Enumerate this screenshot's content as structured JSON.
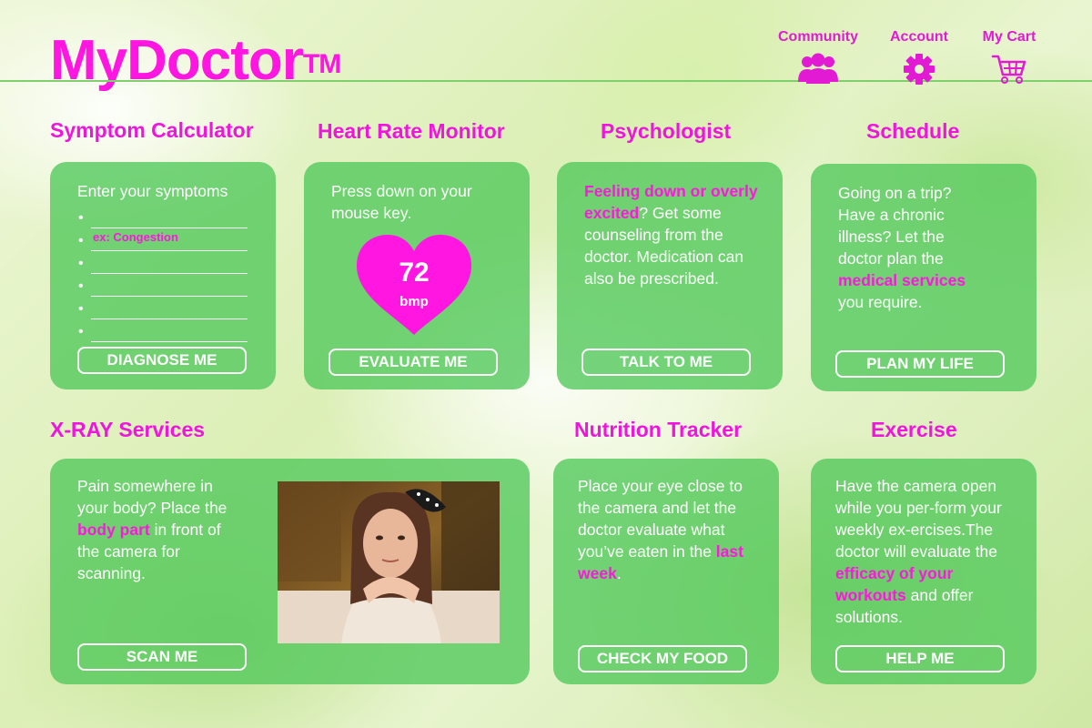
{
  "header": {
    "logo": "MyDoctor",
    "logo_mark": "TM",
    "nav": [
      {
        "label": "Community",
        "icon": "community-icon"
      },
      {
        "label": "Account",
        "icon": "gear-icon"
      },
      {
        "label": "My Cart",
        "icon": "cart-icon"
      }
    ]
  },
  "colors": {
    "accent": "#ff16e0",
    "card": "#50c85a",
    "line": "#7fd06a"
  },
  "symptom": {
    "title": "Symptom Calculator",
    "prompt": "Enter your symptoms",
    "example": "ex: Congestion",
    "button": "DIAGNOSE ME"
  },
  "heart": {
    "title": "Heart Rate Monitor",
    "text": "Press down on your mouse key.",
    "value": "72",
    "unit": "bmp",
    "button": "EVALUATE ME"
  },
  "psych": {
    "title": "Psychologist",
    "highlight": "Feeling down or overly excited",
    "text": "? Get some counseling from the doctor. Medication can also be prescribed.",
    "button": "TALK TO ME"
  },
  "schedule": {
    "title": "Schedule",
    "text": "Going on a trip? Have a chronic illness? Let the doctor plan the",
    "highlight": "medical services",
    "text_end": "you require.",
    "button": "PLAN MY LIFE"
  },
  "xray": {
    "title": "X-RAY Services",
    "text": "Pain somewhere in your body? Place the",
    "highlight": "body part",
    "text_end": "in front of the camera for scanning.",
    "button": "SCAN ME"
  },
  "nutrition": {
    "title": "Nutrition Tracker",
    "text": "Place your eye close to the camera and let the doctor evaluate what you’ve eaten in the",
    "highlight": "last week",
    "text_end": ".",
    "button": "CHECK MY FOOD"
  },
  "exercise": {
    "title": "Exercise",
    "text": "Have the camera open while you per-form your weekly ex-ercises.The doctor will evaluate the",
    "highlight": "efficacy of your workouts",
    "text_end": "and offer solutions.",
    "button": "HELP ME"
  }
}
